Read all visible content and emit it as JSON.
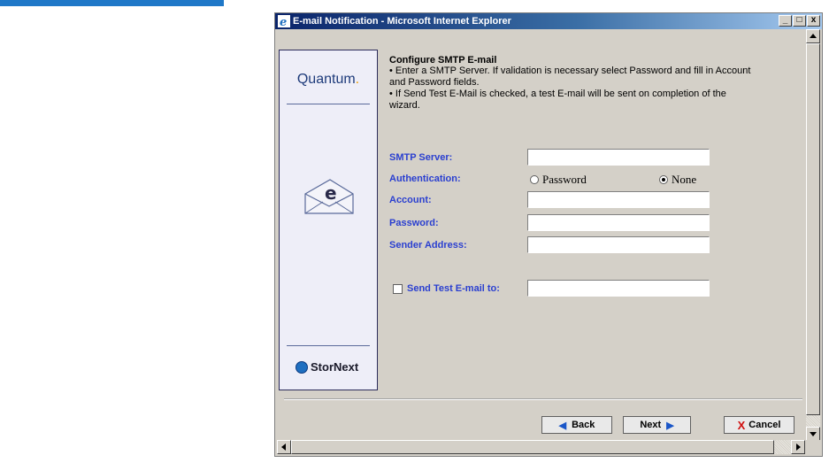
{
  "window": {
    "title": "E-mail Notification - Microsoft Internet Explorer",
    "controls": {
      "minimize": "_",
      "maximize": "□",
      "close": "x"
    }
  },
  "brand": {
    "quantum_logo": "Quantum",
    "quantum_dot": ".",
    "envelope_letter": "e",
    "stornext_logo": "StorNext"
  },
  "wizard": {
    "heading": "Configure SMTP E-mail",
    "instructions": [
      "• Enter a SMTP Server. If validation is necessary select Password and fill in Account and Password fields.",
      "• If Send Test E-Mail is checked, a test E-mail will be sent on completion of the wizard."
    ],
    "fields": {
      "smtp_server": {
        "label": "SMTP Server:",
        "value": ""
      },
      "authentication": {
        "label": "Authentication:",
        "password_option": "Password",
        "none_option": "None",
        "selected": "None"
      },
      "account": {
        "label": "Account:",
        "value": ""
      },
      "password": {
        "label": "Password:",
        "value": ""
      },
      "sender_address": {
        "label": "Sender Address:",
        "value": ""
      },
      "send_test": {
        "label": "Send Test E-mail to:",
        "checked": false,
        "value": ""
      }
    }
  },
  "buttons": {
    "back": "Back",
    "next": "Next",
    "cancel": "Cancel",
    "back_icon": "◀",
    "next_icon": "▶",
    "cancel_icon": "X"
  },
  "colors": {
    "label_blue": "#2a3fd0",
    "title_bar": "#0a246a",
    "dialog_bg": "#d4d0c8",
    "cancel_red": "#d01010"
  }
}
